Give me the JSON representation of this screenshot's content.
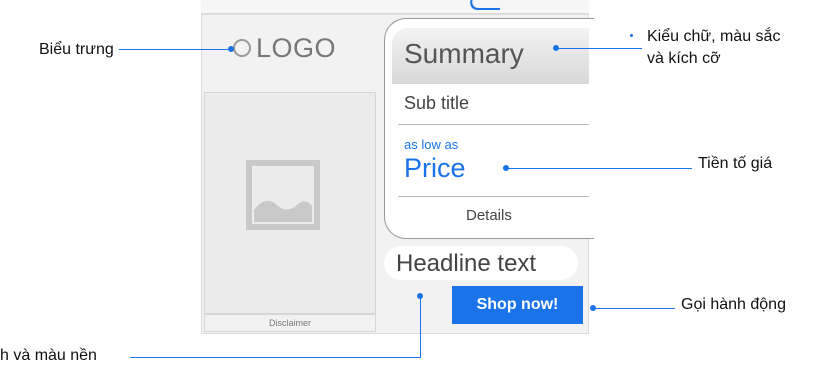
{
  "ad": {
    "logo_text": "LOGO",
    "disclaimer": "Disclaimer",
    "summary": "Summary",
    "subtitle": "Sub title",
    "price_prefix": "as low as",
    "price": "Price",
    "details": "Details",
    "headline": "Headline text",
    "cta_label": "Shop now!"
  },
  "callouts": {
    "logo": "Biểu trưng",
    "font_line1": "Kiểu chữ, màu sắc",
    "font_line2": "và kích cỡ",
    "price_prefix": "Tiền tố giá",
    "cta": "Gọi hành động",
    "background": "h và màu nền"
  },
  "colors": {
    "accent": "#1a73e8",
    "text_dark": "#444444",
    "panel": "#f2f2f2"
  },
  "icons": {
    "logo": "circle-logo-icon",
    "image": "image-placeholder-icon"
  }
}
